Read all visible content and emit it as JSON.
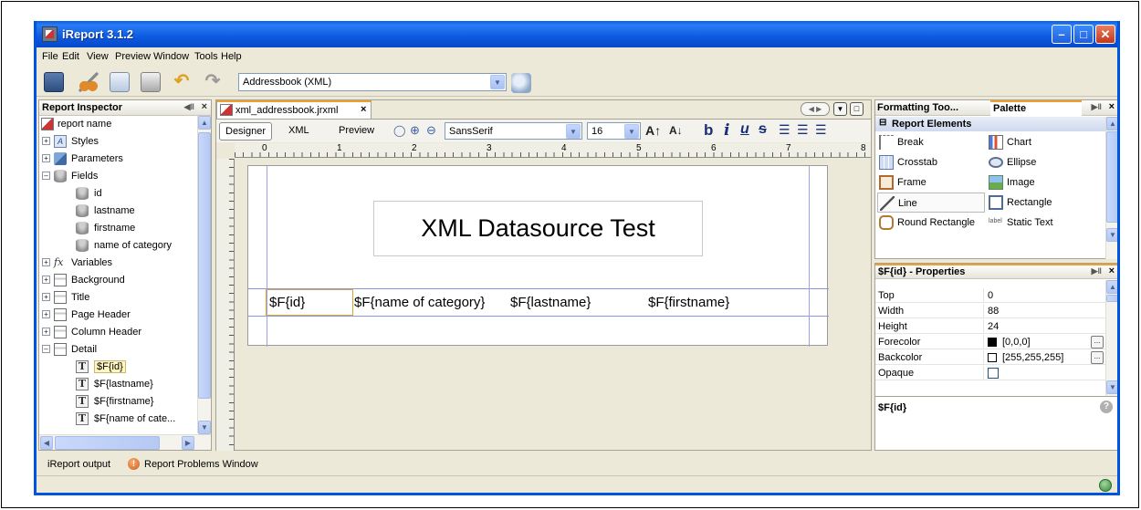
{
  "window": {
    "title": "iReport 3.1.2"
  },
  "menu": [
    "File",
    "Edit",
    "View",
    "Preview",
    "Window",
    "Tools",
    "Help"
  ],
  "toolbar": {
    "datasource_value": "Addressbook (XML)"
  },
  "inspector": {
    "title": "Report Inspector",
    "items": [
      {
        "label": "report name"
      },
      {
        "label": "Styles"
      },
      {
        "label": "Parameters"
      },
      {
        "label": "Fields"
      },
      {
        "label": "id"
      },
      {
        "label": "lastname"
      },
      {
        "label": "firstname"
      },
      {
        "label": "name of category"
      },
      {
        "label": "Variables"
      },
      {
        "label": "Background"
      },
      {
        "label": "Title"
      },
      {
        "label": "Page Header"
      },
      {
        "label": "Column Header"
      },
      {
        "label": "Detail"
      },
      {
        "label": "$F{id}"
      },
      {
        "label": "$F{lastname}"
      },
      {
        "label": "$F{firstname}"
      },
      {
        "label": "$F{name of cate..."
      }
    ]
  },
  "editor": {
    "tab_label": "xml_addressbook.jrxml",
    "modes": [
      "Designer",
      "XML",
      "Preview"
    ],
    "font_name": "SansSerif",
    "font_size": "16",
    "ruler_numbers": [
      "0",
      "1",
      "2",
      "3",
      "4",
      "5",
      "6",
      "7",
      "8"
    ],
    "report_title": "XML Datasource Test",
    "fields": [
      "$F{id}",
      "$F{name of category}",
      "$F{lastname}",
      "$F{firstname}"
    ]
  },
  "palette": {
    "tabs": [
      "Formatting Too...",
      "Palette"
    ],
    "section": "Report Elements",
    "items": [
      "Break",
      "Chart",
      "Crosstab",
      "Ellipse",
      "Frame",
      "Image",
      "Line",
      "Rectangle",
      "Round Rectangle",
      "Static Text"
    ]
  },
  "properties": {
    "title": "$F{id} - Properties",
    "rows": [
      {
        "key": "Top",
        "value": "0"
      },
      {
        "key": "Width",
        "value": "88"
      },
      {
        "key": "Height",
        "value": "24"
      },
      {
        "key": "Forecolor",
        "value": "[0,0,0]"
      },
      {
        "key": "Backcolor",
        "value": "[255,255,255]"
      },
      {
        "key": "Opaque",
        "value": ""
      }
    ],
    "footer_label": "$F{id}"
  },
  "output_tabs": [
    "iReport output",
    "Report Problems Window"
  ],
  "colors": {
    "xp_blue": "#0054e3",
    "forecolor_swatch": "#000000",
    "backcolor_swatch": "#ffffff"
  }
}
